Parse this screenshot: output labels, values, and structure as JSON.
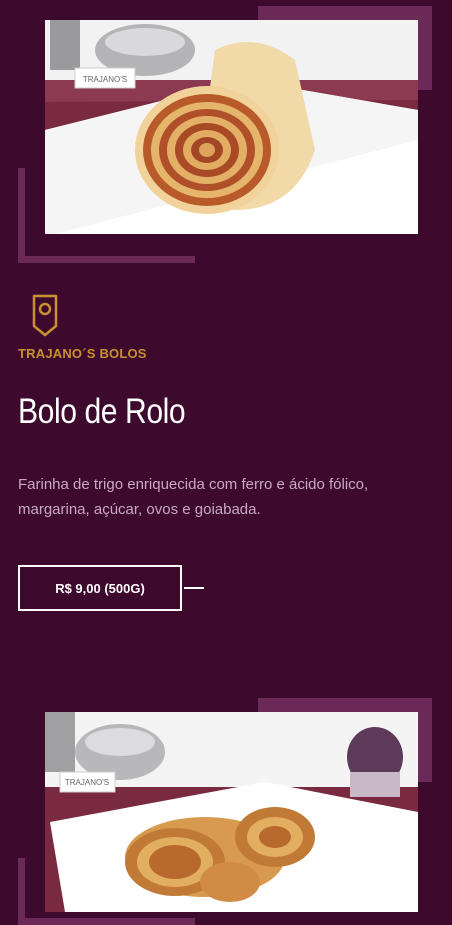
{
  "product": {
    "brand": "TRAJANO´S BOLOS",
    "name": "Bolo de Rolo",
    "description": "Farinha de trigo enriquecida com ferro e ácido fólico, margarina, açúcar, ovos e goiabada.",
    "price_label": "R$ 9,00 (500G)",
    "brand_icon": "map-pin-icon",
    "image_label": "TRAJANO'S"
  },
  "next_product": {
    "image_label": "TRAJANO'S"
  },
  "colors": {
    "background": "#3d0a2e",
    "accent_gold": "#c8902e",
    "frame": "#6b2a58",
    "text_light": "#c9a8c3"
  }
}
